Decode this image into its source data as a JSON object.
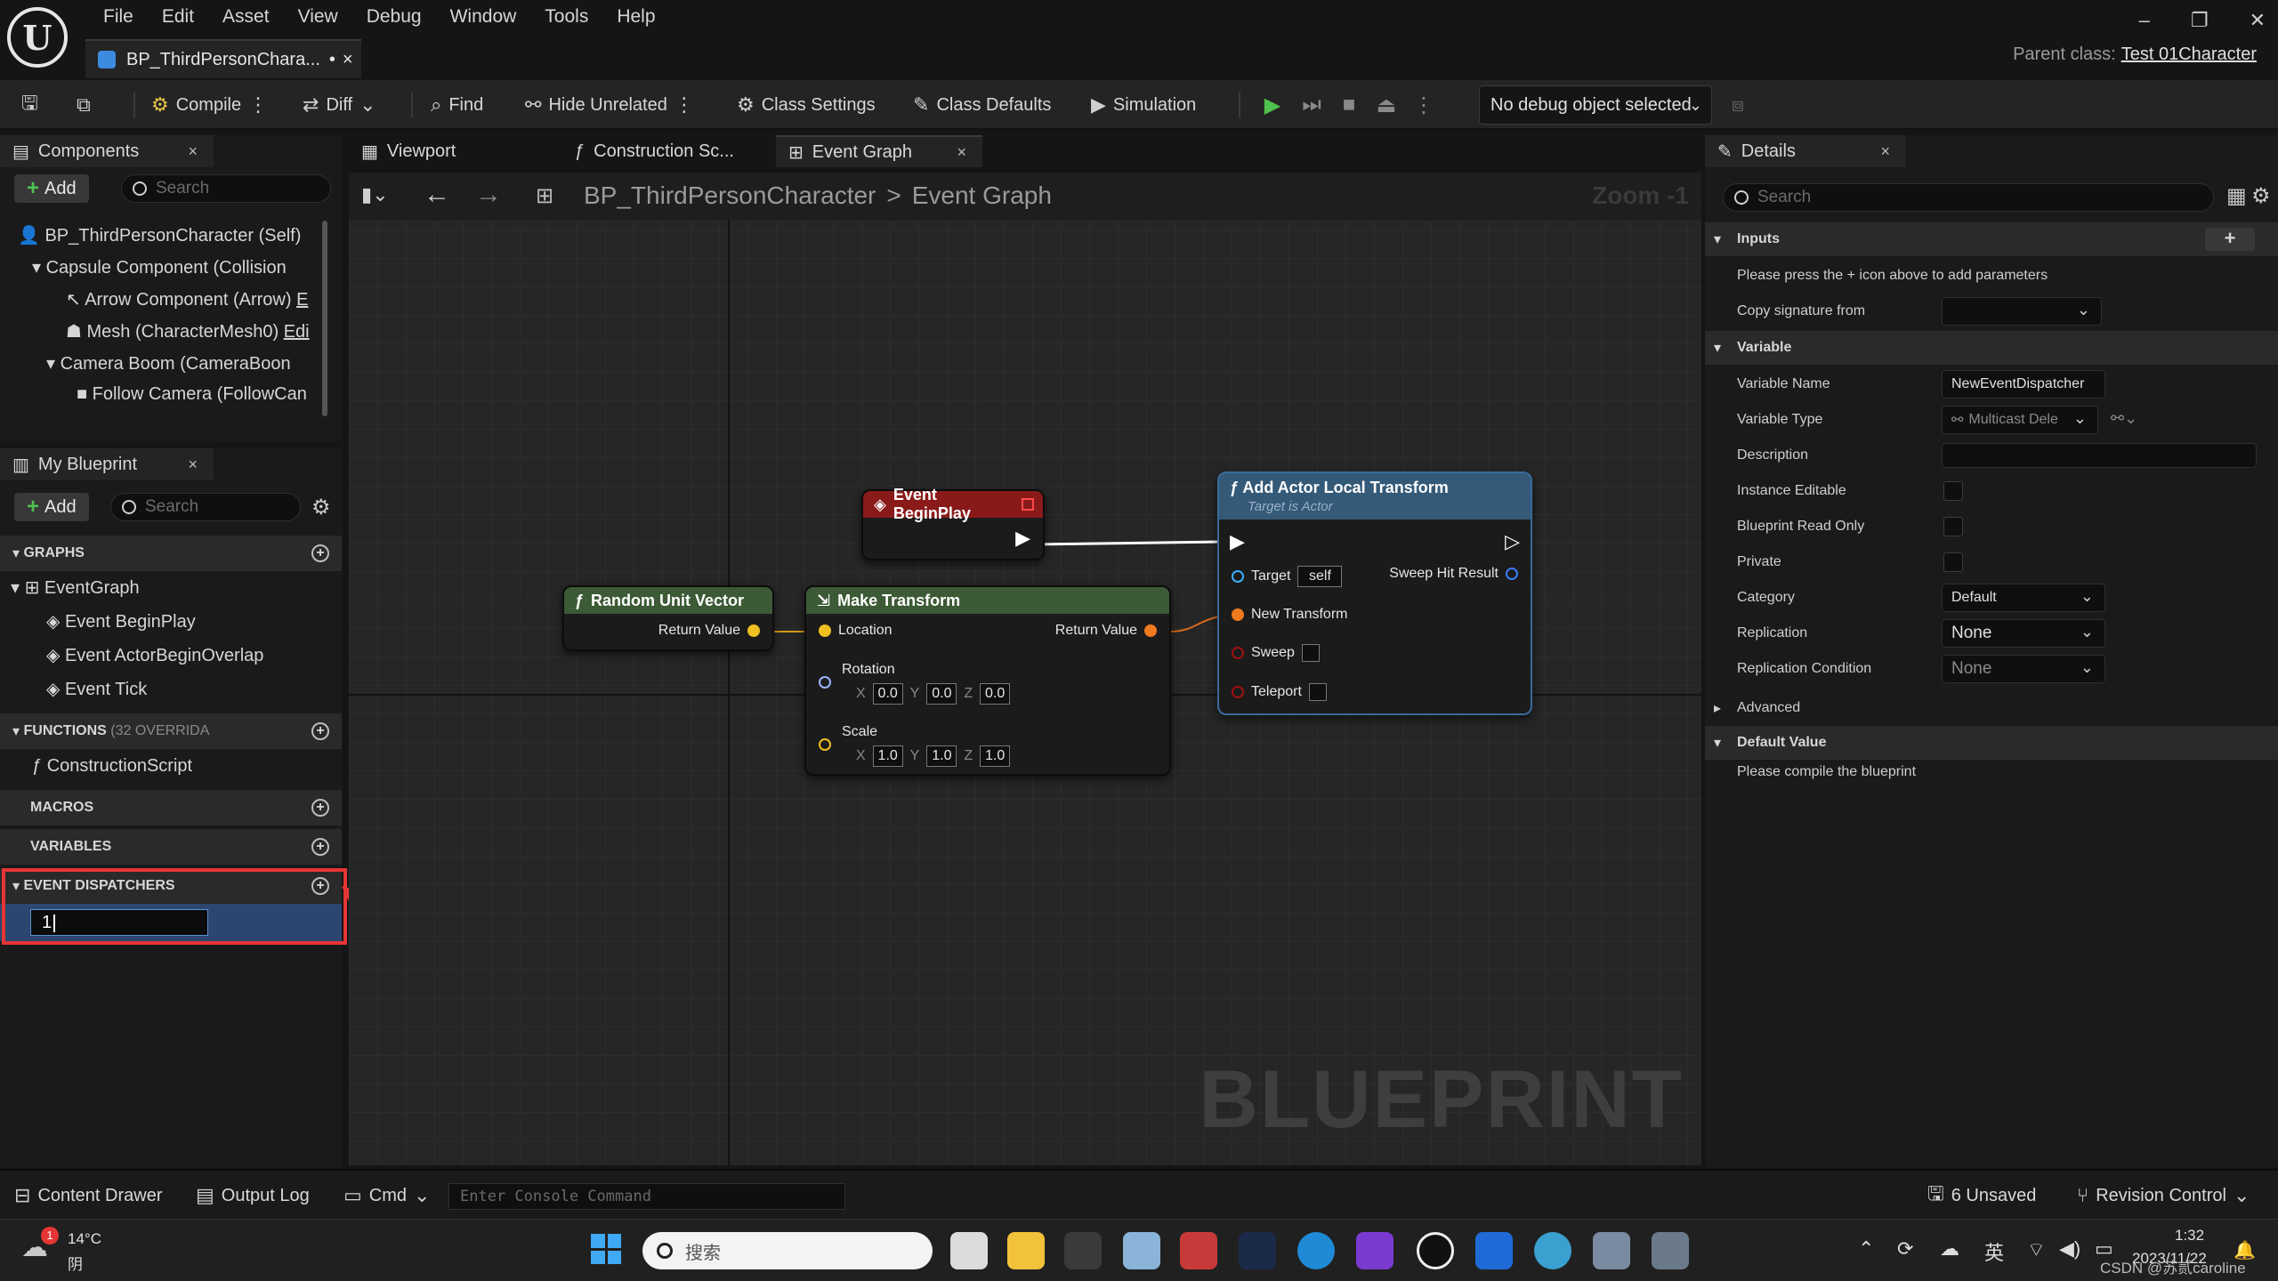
{
  "menu": [
    "File",
    "Edit",
    "Asset",
    "View",
    "Debug",
    "Window",
    "Tools",
    "Help"
  ],
  "doc_tab": {
    "title": "BP_ThirdPersonChara...",
    "dirty": "•",
    "close": "×"
  },
  "window": {
    "min": "–",
    "max": "❐",
    "close": "✕"
  },
  "parent_class": {
    "label": "Parent class:",
    "value": "Test 01Character"
  },
  "toolbar": {
    "compile": "Compile",
    "diff": "Diff",
    "find": "Find",
    "hide_unrelated": "Hide Unrelated",
    "class_settings": "Class Settings",
    "class_defaults": "Class Defaults",
    "simulation": "Simulation",
    "debug_object": "No debug object selected"
  },
  "components": {
    "tab": "Components",
    "add": "Add",
    "search_placeholder": "Search",
    "items": [
      "BP_ThirdPersonCharacter (Self)",
      "Capsule Component (Collision",
      "Arrow Component (Arrow)",
      "Mesh (CharacterMesh0)",
      "Camera Boom (CameraBoon",
      "Follow Camera (FollowCan"
    ],
    "edit_suffix_arrow": "E",
    "edit_suffix_mesh": "Edi"
  },
  "my_blueprint": {
    "tab": "My Blueprint",
    "add": "Add",
    "search_placeholder": "Search",
    "graphs_header": "GRAPHS",
    "event_graph": "EventGraph",
    "events": [
      "Event BeginPlay",
      "Event ActorBeginOverlap",
      "Event Tick"
    ],
    "functions_header": "FUNCTIONS",
    "functions_override": "(32 OVERRIDA",
    "construction": "ConstructionScript",
    "macros_header": "MACROS",
    "variables_header": "VARIABLES",
    "dispatchers_header": "EVENT DISPATCHERS",
    "new_dispatcher_value": "1"
  },
  "editor_tabs": {
    "viewport": "Viewport",
    "construction": "Construction Sc...",
    "event_graph": "Event Graph",
    "close": "×"
  },
  "breadcrumb": {
    "root": "BP_ThirdPersonCharacter",
    "sep": ">",
    "current": "Event Graph"
  },
  "zoom": "Zoom -1",
  "watermark": "BLUEPRINT",
  "nodes": {
    "begin_play": "Event BeginPlay",
    "random_unit": "Random Unit Vector",
    "return_value": "Return Value",
    "make_transform": "Make Transform",
    "location": "Location",
    "rotation": "Rotation",
    "scale": "Scale",
    "rot": {
      "x": "0.0",
      "y": "0.0",
      "z": "0.0"
    },
    "scl": {
      "x": "1.0",
      "y": "1.0",
      "z": "1.0"
    },
    "axis": {
      "x": "X",
      "y": "Y",
      "z": "Z"
    },
    "add_local": "Add Actor Local Transform",
    "target_is": "Target is Actor",
    "target": "Target",
    "self": "self",
    "sweep_hit": "Sweep Hit Result",
    "new_transform": "New Transform",
    "sweep": "Sweep",
    "teleport": "Teleport"
  },
  "details": {
    "tab": "Details",
    "search_placeholder": "Search",
    "inputs_header": "Inputs",
    "inputs_hint": "Please press the + icon above to add parameters",
    "copy_sig": "Copy signature from",
    "variable_header": "Variable",
    "var_name_label": "Variable Name",
    "var_name_value": "NewEventDispatcher",
    "var_type_label": "Variable Type",
    "var_type_value": "Multicast Dele",
    "description": "Description",
    "instance_editable": "Instance Editable",
    "bp_readonly": "Blueprint Read Only",
    "private": "Private",
    "category_label": "Category",
    "category_value": "Default",
    "replication_label": "Replication",
    "replication_value": "None",
    "rep_cond_label": "Replication Condition",
    "rep_cond_value": "None",
    "advanced": "Advanced",
    "default_value_header": "Default Value",
    "compile_hint": "Please compile the blueprint"
  },
  "bottom": {
    "content_drawer": "Content Drawer",
    "output_log": "Output Log",
    "cmd": "Cmd",
    "console_placeholder": "Enter Console Command",
    "unsaved": "6 Unsaved",
    "revision": "Revision Control"
  },
  "taskbar": {
    "weather_temp": "14°C",
    "weather_desc": "阴",
    "weather_badge": "1",
    "search_placeholder": "搜索",
    "ime": "英",
    "time": "1:32",
    "date": "2023/11/22",
    "watermark": "CSDN @苏贰caroline"
  }
}
